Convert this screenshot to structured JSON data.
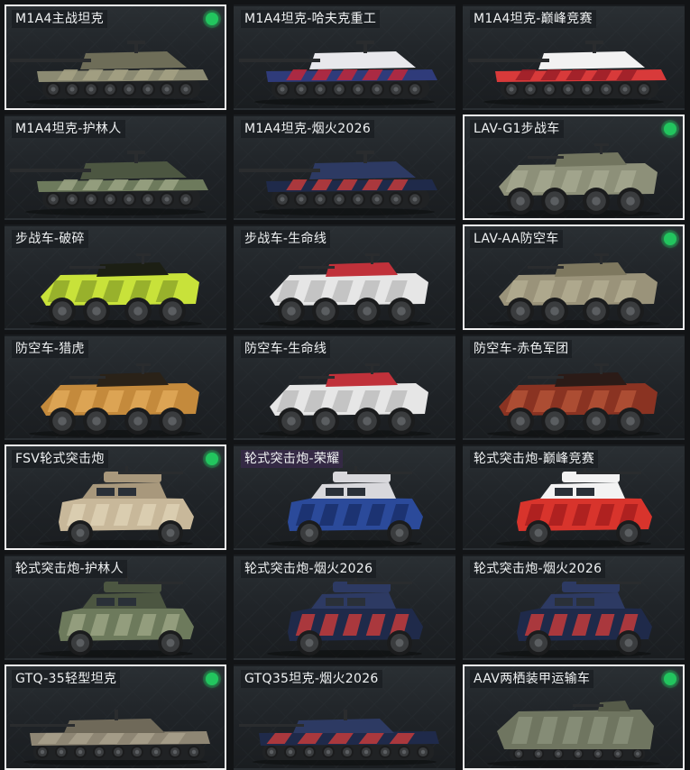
{
  "colors": {
    "owned_badge": "#22c55e",
    "selected_border": "#f2f2f2"
  },
  "cards": [
    {
      "label": "M1A4主战坦克",
      "kind": "tank",
      "selected": true,
      "owned": true,
      "camo": [
        "#8b8a72",
        "#6e6d58",
        "#a4a184"
      ]
    },
    {
      "label": "M1A4坦克-哈夫克重工",
      "kind": "tank",
      "selected": false,
      "owned": false,
      "camo": [
        "#2f3b7a",
        "#e8e8ec",
        "#c0283a"
      ]
    },
    {
      "label": "M1A4坦克-巅峰竞赛",
      "kind": "tank",
      "selected": false,
      "owned": false,
      "camo": [
        "#d83a3a",
        "#f2f2f2",
        "#9a1f28"
      ]
    },
    {
      "label": "M1A4坦克-护林人",
      "kind": "tank",
      "selected": false,
      "owned": false,
      "camo": [
        "#6d7a5c",
        "#4c5641",
        "#9aa382"
      ]
    },
    {
      "label": "M1A4坦克-烟火2026",
      "kind": "tank",
      "selected": false,
      "owned": false,
      "camo": [
        "#1f2a4a",
        "#2d3a63",
        "#c33b3b"
      ]
    },
    {
      "label": "LAV-G1步战车",
      "kind": "apc",
      "selected": true,
      "owned": true,
      "camo": [
        "#8d9079",
        "#72755f",
        "#a5a88f"
      ]
    },
    {
      "label": "步战车-破碎",
      "kind": "apc",
      "selected": false,
      "owned": false,
      "camo": [
        "#c8e23a",
        "#1c1f14",
        "#8fa82a"
      ]
    },
    {
      "label": "步战车-生命线",
      "kind": "apc",
      "selected": false,
      "owned": false,
      "camo": [
        "#e6e6e6",
        "#c0313a",
        "#bdbdbd"
      ]
    },
    {
      "label": "LAV-AA防空车",
      "kind": "apc",
      "selected": true,
      "owned": true,
      "camo": [
        "#9a937a",
        "#7e785f",
        "#b2ab91"
      ]
    },
    {
      "label": "防空车-猎虎",
      "kind": "apc",
      "selected": false,
      "owned": false,
      "camo": [
        "#c48a3c",
        "#2a2218",
        "#e0a858"
      ]
    },
    {
      "label": "防空车-生命线",
      "kind": "apc",
      "selected": false,
      "owned": false,
      "camo": [
        "#e6e6e6",
        "#c0313a",
        "#bdbdbd"
      ]
    },
    {
      "label": "防空车-赤色军团",
      "kind": "apc",
      "selected": false,
      "owned": false,
      "camo": [
        "#8a3322",
        "#2b1b17",
        "#b25236"
      ]
    },
    {
      "label": "FSV轮式突击炮",
      "kind": "wheeled",
      "selected": true,
      "owned": true,
      "camo": [
        "#c8b89a",
        "#a8987c",
        "#ddd0b4"
      ]
    },
    {
      "label": "轮式突击炮-荣耀",
      "kind": "wheeled",
      "selected": false,
      "owned": false,
      "purple": true,
      "camo": [
        "#2b4a9a",
        "#d8d8dc",
        "#1a2f6b"
      ]
    },
    {
      "label": "轮式突击炮-巅峰竞赛",
      "kind": "wheeled",
      "selected": false,
      "owned": false,
      "camo": [
        "#d8342c",
        "#f3f3f3",
        "#a81e1e"
      ]
    },
    {
      "label": "轮式突击炮-护林人",
      "kind": "wheeled",
      "selected": false,
      "owned": false,
      "camo": [
        "#6d7a5c",
        "#4c5641",
        "#9aa382"
      ]
    },
    {
      "label": "轮式突击炮-烟火2026",
      "kind": "wheeled",
      "selected": false,
      "owned": false,
      "camo": [
        "#1f2a4a",
        "#2d3a63",
        "#c33b3b"
      ]
    },
    {
      "label": "轮式突击炮-烟火2026",
      "kind": "wheeled",
      "selected": false,
      "owned": false,
      "camo": [
        "#1f2a4a",
        "#2d3a63",
        "#c33b3b"
      ]
    },
    {
      "label": "GTQ-35轻型坦克",
      "kind": "light",
      "selected": true,
      "owned": true,
      "camo": [
        "#8e8674",
        "#6f6959",
        "#a8a08c"
      ]
    },
    {
      "label": "GTQ35坦克-烟火2026",
      "kind": "light",
      "selected": false,
      "owned": false,
      "camo": [
        "#1f2a4a",
        "#2d3a63",
        "#c33b3b"
      ]
    },
    {
      "label": "AAV两栖装甲运输车",
      "kind": "amphib",
      "selected": true,
      "owned": true,
      "camo": [
        "#6f7560",
        "#565b49",
        "#8a907a"
      ]
    }
  ]
}
